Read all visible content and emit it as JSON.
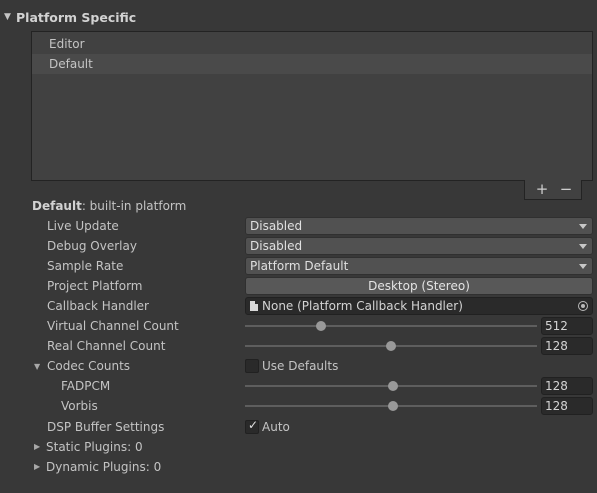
{
  "section": {
    "title": "Platform Specific"
  },
  "platform_list": {
    "items": [
      "Editor",
      "Default"
    ],
    "selected": "Default",
    "add_label": "+",
    "remove_label": "−"
  },
  "current": {
    "name": "Default",
    "suffix": ": built-in platform"
  },
  "properties": {
    "live_update": {
      "label": "Live Update",
      "value": "Disabled"
    },
    "debug_overlay": {
      "label": "Debug Overlay",
      "value": "Disabled"
    },
    "sample_rate": {
      "label": "Sample Rate",
      "value": "Platform Default"
    },
    "project_platform": {
      "label": "Project Platform",
      "value": "Desktop (Stereo)"
    },
    "callback_handler": {
      "label": "Callback Handler",
      "value": "None (Platform Callback Handler)"
    },
    "virtual_channel_count": {
      "label": "Virtual Channel Count",
      "value": "512"
    },
    "real_channel_count": {
      "label": "Real Channel Count",
      "value": "128"
    },
    "codec_counts": {
      "label": "Codec Counts",
      "use_defaults_label": "Use Defaults",
      "use_defaults": false,
      "fadpcm": {
        "label": "FADPCM",
        "value": "128"
      },
      "vorbis": {
        "label": "Vorbis",
        "value": "128"
      }
    },
    "dsp_buffer": {
      "label": "DSP Buffer Settings",
      "auto_label": "Auto",
      "auto": true
    },
    "static_plugins": {
      "label": "Static Plugins: 0"
    },
    "dynamic_plugins": {
      "label": "Dynamic Plugins: 0"
    }
  }
}
